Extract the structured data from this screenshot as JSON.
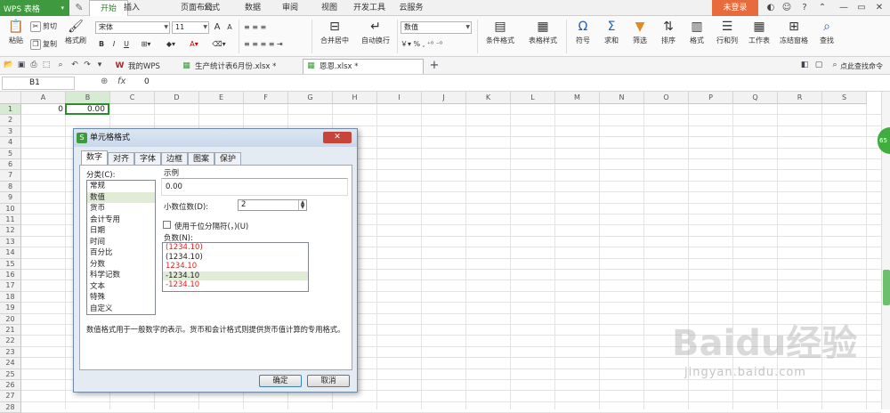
{
  "app": {
    "name": "WPS 表格"
  },
  "menu": {
    "tabs": [
      "开始",
      "插入",
      "页面布局",
      "公式",
      "数据",
      "审阅",
      "视图",
      "开发工具",
      "云服务"
    ],
    "login": "未登录"
  },
  "ribbon": {
    "paste": "粘贴",
    "cut": "剪切",
    "copy": "复制",
    "format_painter": "格式刷",
    "font_name": "宋体",
    "font_size": "11",
    "merge_center": "合并居中",
    "wrap_text": "自动换行",
    "number_format": "数值",
    "cond_format": "条件格式",
    "table_style": "表格样式",
    "symbol": "符号",
    "sum": "求和",
    "filter": "筛选",
    "sort": "排序",
    "format": "格式",
    "row_col": "行和列",
    "worksheet": "工作表",
    "freeze": "冻结窗格",
    "find": "查找"
  },
  "doc_tabs": [
    {
      "label": "我的WPS"
    },
    {
      "label": "生产统计表6月份.xlsx *"
    },
    {
      "label": "恩恩.xlsx *"
    }
  ],
  "quick_search": "点此查找命令",
  "formula_bar": {
    "cell_ref": "B1",
    "fx": "fx",
    "value": "0"
  },
  "sheet": {
    "columns": [
      "A",
      "B",
      "C",
      "D",
      "E",
      "F",
      "G",
      "H",
      "I",
      "J",
      "K",
      "L",
      "M",
      "N",
      "O",
      "P",
      "Q",
      "R",
      "S"
    ],
    "rows": [
      "1",
      "2",
      "3",
      "4",
      "5",
      "6",
      "7",
      "8",
      "9",
      "10",
      "11",
      "12",
      "13",
      "14",
      "15",
      "16",
      "17",
      "18",
      "19",
      "20",
      "21",
      "22",
      "23",
      "24",
      "25",
      "26",
      "27",
      "28"
    ],
    "cell_a1": "0",
    "cell_b1": "0.00"
  },
  "dialog": {
    "title": "单元格格式",
    "tabs": [
      "数字",
      "对齐",
      "字体",
      "边框",
      "图案",
      "保护"
    ],
    "category_label": "分类(C):",
    "categories": [
      "常规",
      "数值",
      "货币",
      "会计专用",
      "日期",
      "时间",
      "百分比",
      "分数",
      "科学记数",
      "文本",
      "特殊",
      "自定义"
    ],
    "sample_label": "示例",
    "sample_value": "0.00",
    "decimal_label": "小数位数(D):",
    "decimal_value": "2",
    "thousands_label": "使用千位分隔符(，)(U)",
    "negative_label": "负数(N):",
    "negatives": [
      "(1234.10)",
      "(1234.10)",
      "1234.10",
      "-1234.10",
      "-1234.10"
    ],
    "description": "数值格式用于一般数字的表示。货币和会计格式则提供货币值计算的专用格式。",
    "ok": "确定",
    "cancel": "取消"
  },
  "side_badge": "65",
  "watermark": {
    "brand": "Baidu经验",
    "url": "jingyan.baidu.com"
  },
  "colors": {
    "accent": "#3f9a3f",
    "login": "#e86b3e",
    "negative_red": "#e02020"
  }
}
